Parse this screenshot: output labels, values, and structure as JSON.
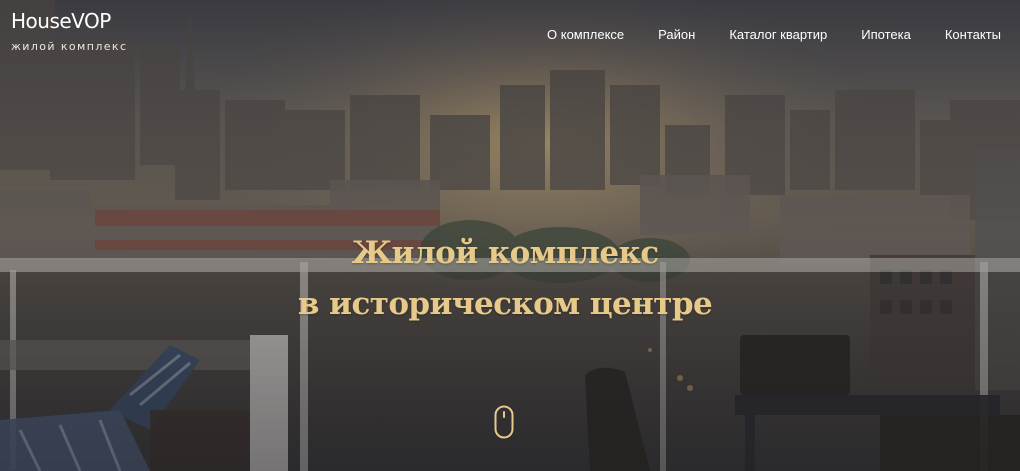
{
  "brand": {
    "name": "HouseVOP",
    "tagline": "жилой комплекс"
  },
  "nav": {
    "items": [
      {
        "label": "О комплексе"
      },
      {
        "label": "Район"
      },
      {
        "label": "Каталог квартир"
      },
      {
        "label": "Ипотека"
      },
      {
        "label": "Контакты"
      }
    ]
  },
  "hero": {
    "headline_line1": "Жилой комплекс",
    "headline_line2": "в историческом центре",
    "scroll_icon": "mouse-scroll-icon"
  },
  "colors": {
    "accent_gold": "#e7c98a",
    "nav_text": "#ffffff",
    "overlay": "#2b2b2d"
  }
}
